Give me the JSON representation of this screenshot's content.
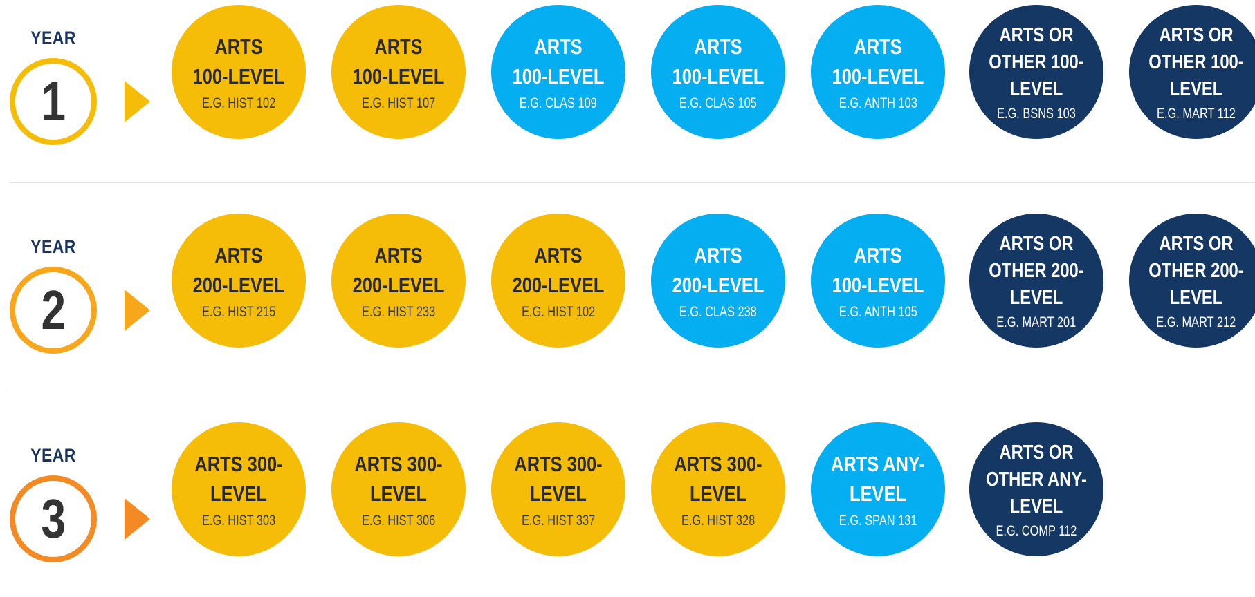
{
  "years": [
    {
      "label": "YEAR",
      "number": "1",
      "ring_color": "#f6bd08",
      "arrow_color": "#f6bd08",
      "courses": [
        {
          "title": "ARTS\n100-LEVEL",
          "example": "E.G. HIST 102",
          "color": "yellow"
        },
        {
          "title": "ARTS\n100-LEVEL",
          "example": "E.G. HIST 107",
          "color": "yellow"
        },
        {
          "title": "ARTS\n100-LEVEL",
          "example": "E.G. CLAS 109",
          "color": "blue"
        },
        {
          "title": "ARTS\n100-LEVEL",
          "example": "E.G. CLAS 105",
          "color": "blue"
        },
        {
          "title": "ARTS\n100-LEVEL",
          "example": "E.G. ANTH 103",
          "color": "blue"
        },
        {
          "title": "ARTS OR\nOTHER 100-\nLEVEL",
          "example": "E.G. BSNS 103",
          "color": "dark"
        },
        {
          "title": "ARTS OR\nOTHER 100-\nLEVEL",
          "example": "E.G. MART 112",
          "color": "dark"
        }
      ]
    },
    {
      "label": "YEAR",
      "number": "2",
      "ring_color": "#f8a61b",
      "arrow_color": "#f8a61b",
      "courses": [
        {
          "title": "ARTS\n200-LEVEL",
          "example": "E.G. HIST 215",
          "color": "yellow"
        },
        {
          "title": "ARTS\n200-LEVEL",
          "example": "E.G. HIST 233",
          "color": "yellow"
        },
        {
          "title": "ARTS\n200-LEVEL",
          "example": "E.G. HIST 102",
          "color": "yellow"
        },
        {
          "title": "ARTS\n200-LEVEL",
          "example": "E.G. CLAS 238",
          "color": "blue"
        },
        {
          "title": "ARTS\n100-LEVEL",
          "example": "E.G. ANTH 105",
          "color": "blue"
        },
        {
          "title": "ARTS OR\nOTHER 200-\nLEVEL",
          "example": "E.G. MART 201",
          "color": "dark"
        },
        {
          "title": "ARTS OR\nOTHER 200-\nLEVEL",
          "example": "E.G. MART 212",
          "color": "dark"
        }
      ]
    },
    {
      "label": "YEAR",
      "number": "3",
      "ring_color": "#f48a23",
      "arrow_color": "#f48a23",
      "courses": [
        {
          "title": "ARTS 300-\nLEVEL",
          "example": "E.G. HIST 303",
          "color": "yellow"
        },
        {
          "title": "ARTS 300-\nLEVEL",
          "example": "E.G. HIST 306",
          "color": "yellow"
        },
        {
          "title": "ARTS 300-\nLEVEL",
          "example": "E.G. HIST 337",
          "color": "yellow"
        },
        {
          "title": "ARTS 300-\nLEVEL",
          "example": "E.G. HIST 328",
          "color": "yellow"
        },
        {
          "title": "ARTS ANY-\nLEVEL",
          "example": "E.G. SPAN 131",
          "color": "blue"
        },
        {
          "title": "ARTS OR\nOTHER ANY-\nLEVEL",
          "example": "E.G. COMP 112",
          "color": "dark"
        }
      ]
    }
  ]
}
